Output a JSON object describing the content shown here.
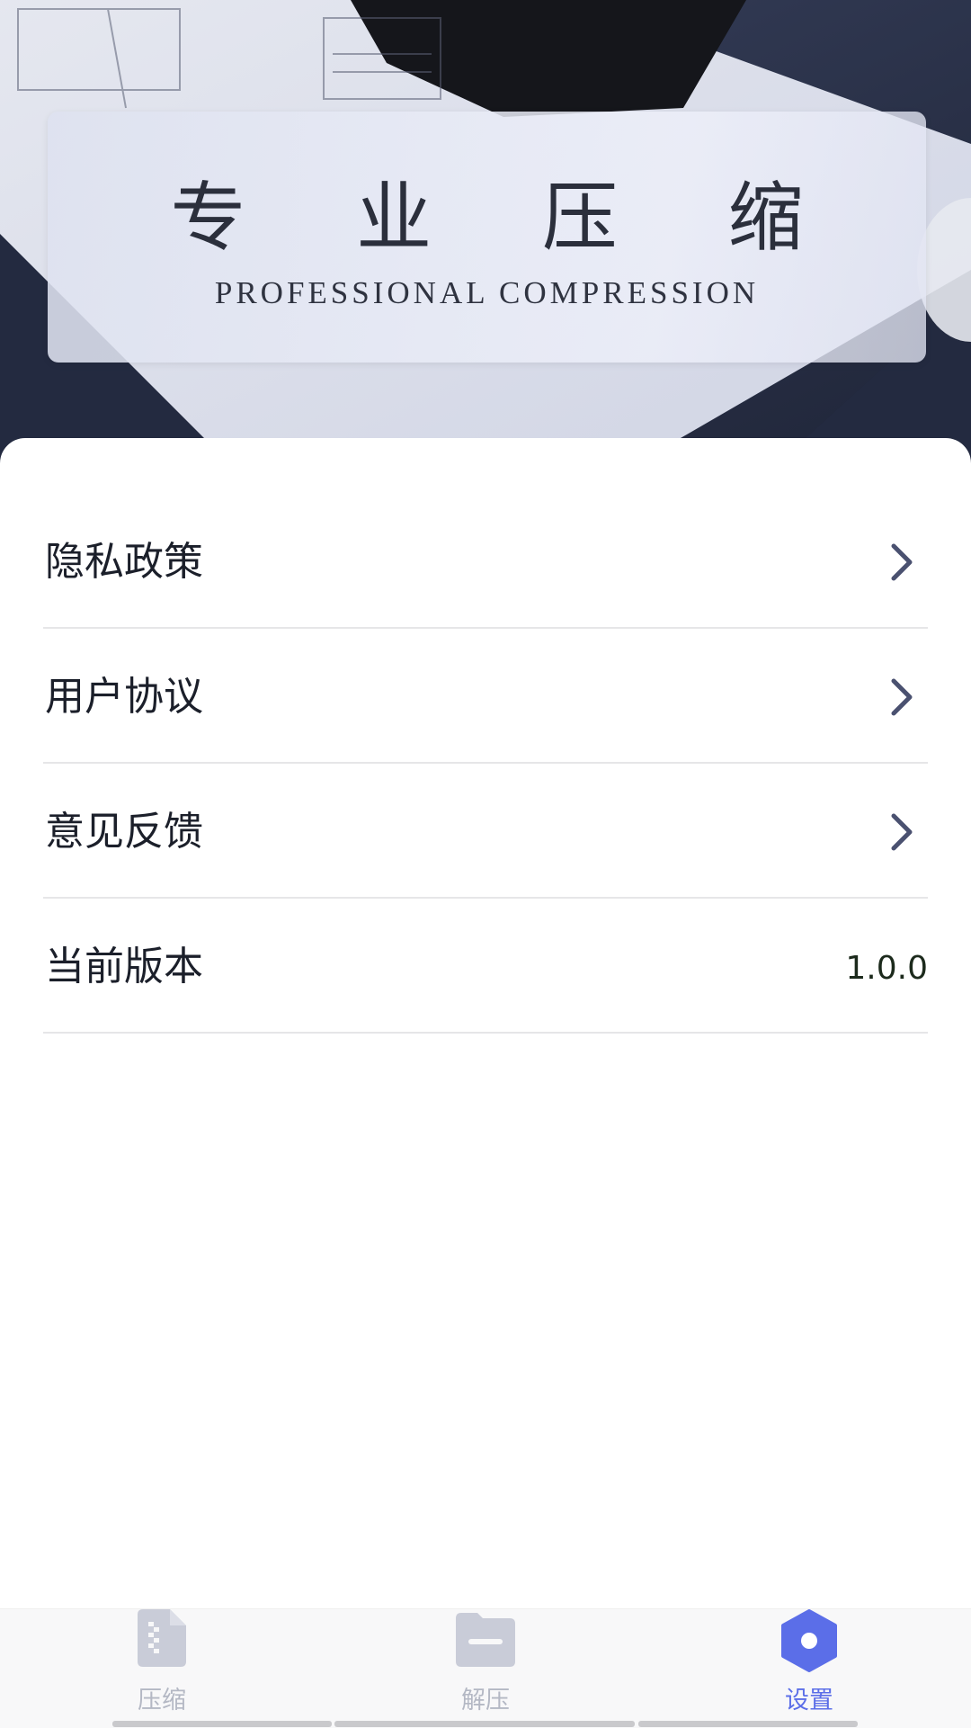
{
  "banner": {
    "title": "专 业 压 缩",
    "subtitle": "PROFESSIONAL COMPRESSION"
  },
  "settings": {
    "items": [
      {
        "label": "隐私政策",
        "icon": "chevron-right-icon"
      },
      {
        "label": "用户协议",
        "icon": "chevron-right-icon"
      },
      {
        "label": "意见反馈",
        "icon": "chevron-right-icon"
      },
      {
        "label": "当前版本",
        "value": "1.0.0"
      }
    ]
  },
  "tabbar": {
    "tabs": [
      {
        "label": "压缩",
        "icon": "zip-file-icon",
        "active": false
      },
      {
        "label": "解压",
        "icon": "folder-icon",
        "active": false
      },
      {
        "label": "设置",
        "icon": "settings-hexagon-icon",
        "active": true
      }
    ]
  },
  "colors": {
    "accent": "#5b6ee8",
    "inactive_tab": "#b4b8c4",
    "chevron": "#4a5170",
    "divider": "#e6e6e8"
  }
}
